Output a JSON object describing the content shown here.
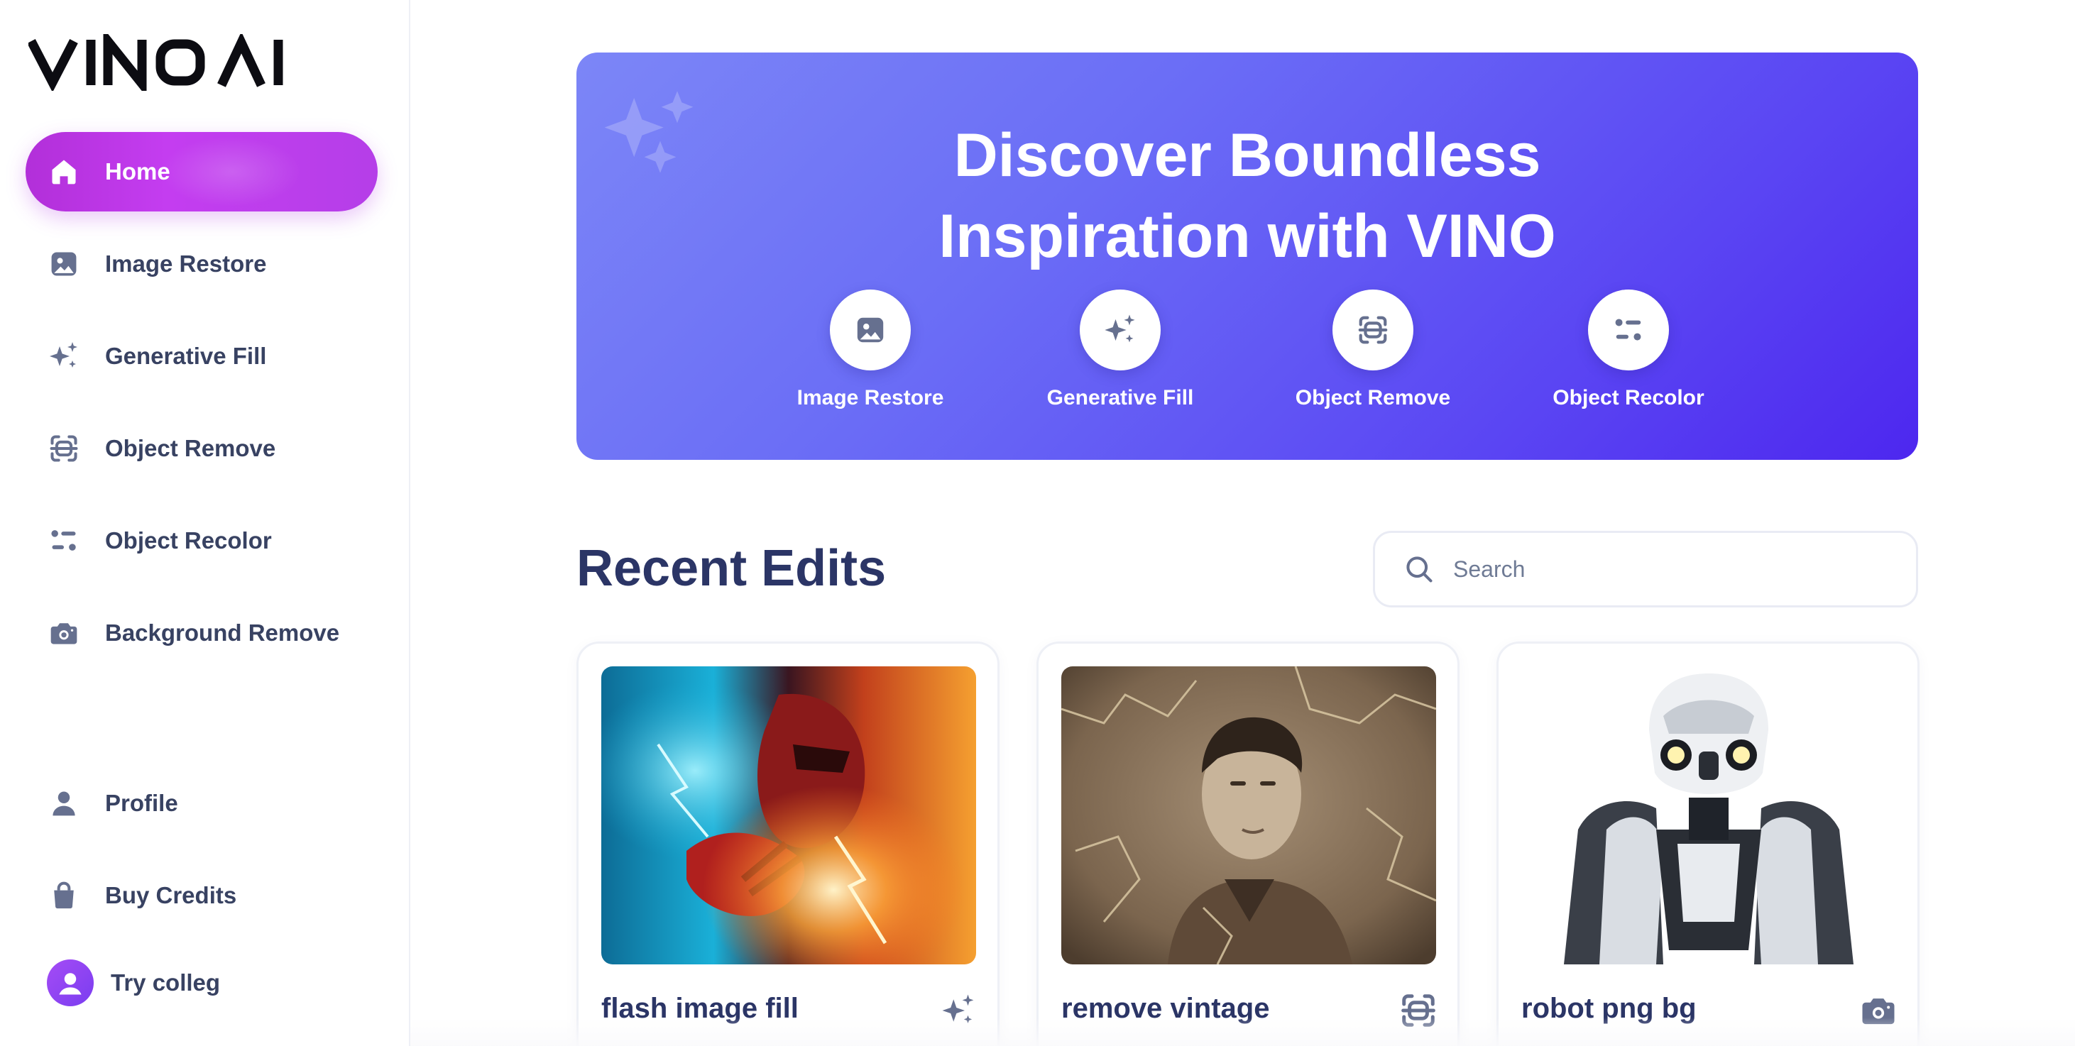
{
  "brand": {
    "name": "VINO AI"
  },
  "sidebar": {
    "items": [
      {
        "label": "Home",
        "icon": "home-icon",
        "active": true
      },
      {
        "label": "Image Restore",
        "icon": "image-icon"
      },
      {
        "label": "Generative Fill",
        "icon": "sparkles-icon"
      },
      {
        "label": "Object Remove",
        "icon": "scan-icon"
      },
      {
        "label": "Object Recolor",
        "icon": "recolor-icon"
      },
      {
        "label": "Background Remove",
        "icon": "camera-icon"
      }
    ],
    "bottom_items": [
      {
        "label": "Profile",
        "icon": "user-icon"
      },
      {
        "label": "Buy Credits",
        "icon": "bag-icon"
      }
    ],
    "user": {
      "label": "Try colleg",
      "icon": "avatar-icon"
    }
  },
  "hero": {
    "title_line1": "Discover Boundless",
    "title_line2": "Inspiration with VINO",
    "features": [
      {
        "label": "Image Restore",
        "icon": "image-icon"
      },
      {
        "label": "Generative Fill",
        "icon": "sparkles-icon"
      },
      {
        "label": "Object Remove",
        "icon": "scan-icon"
      },
      {
        "label": "Object Recolor",
        "icon": "recolor-icon"
      }
    ]
  },
  "recent": {
    "title": "Recent Edits",
    "search_placeholder": "Search",
    "cards": [
      {
        "title": "flash image fill",
        "icon": "sparkles-icon"
      },
      {
        "title": "remove vintage",
        "icon": "scan-icon"
      },
      {
        "title": "robot png bg",
        "icon": "camera-icon"
      }
    ]
  },
  "colors": {
    "accent_purple": "#c13cec",
    "hero_start": "#7c86f7",
    "hero_end": "#4d27ef",
    "heading": "#2b3566",
    "icon_gray": "#66708f"
  }
}
